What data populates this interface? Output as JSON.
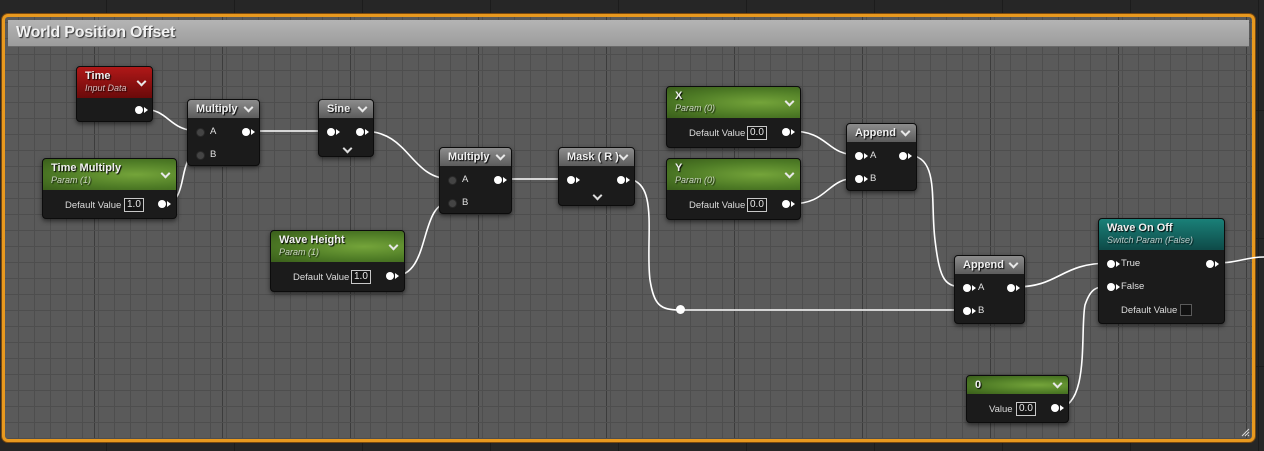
{
  "comment": {
    "title": "World Position Offset"
  },
  "nodes": {
    "time": {
      "title": "Time",
      "subtitle": "Input Data"
    },
    "time_multiply": {
      "title": "Time Multiply",
      "subtitle": "Param (1)",
      "default_label": "Default Value",
      "default_value": "1.0"
    },
    "multiply1": {
      "title": "Multiply",
      "pin_a": "A",
      "pin_b": "B"
    },
    "sine": {
      "title": "Sine"
    },
    "multiply2": {
      "title": "Multiply",
      "pin_a": "A",
      "pin_b": "B"
    },
    "wave_height": {
      "title": "Wave Height",
      "subtitle": "Param (1)",
      "default_label": "Default Value",
      "default_value": "1.0"
    },
    "mask": {
      "title": "Mask ( R )"
    },
    "x_param": {
      "title": "X",
      "subtitle": "Param (0)",
      "default_label": "Default Value",
      "default_value": "0.0"
    },
    "y_param": {
      "title": "Y",
      "subtitle": "Param (0)",
      "default_label": "Default Value",
      "default_value": "0.0"
    },
    "append1": {
      "title": "Append",
      "pin_a": "A",
      "pin_b": "B"
    },
    "append2": {
      "title": "Append",
      "pin_a": "A",
      "pin_b": "B"
    },
    "wave_on_off": {
      "title": "Wave On Off",
      "subtitle": "Switch Param (False)",
      "pin_true": "True",
      "pin_false": "False",
      "default_label": "Default Value"
    },
    "zero": {
      "title": "0",
      "value_label": "Value",
      "value": "0.0"
    }
  },
  "colors": {
    "comment_border": "#e8991f",
    "param_header": "#4d7a25",
    "time_header": "#b01818",
    "switch_header": "#1a8078",
    "math_header": "#6e6e6e"
  }
}
